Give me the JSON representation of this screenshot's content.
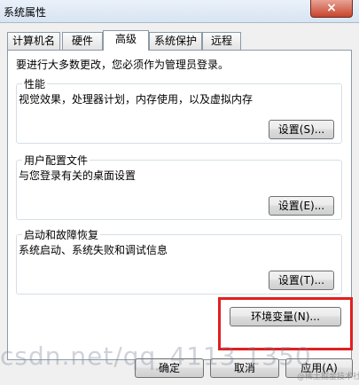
{
  "window": {
    "title": "系统属性",
    "close_glyph": "×"
  },
  "tabs": [
    "计算机名",
    "硬件",
    "高级",
    "系统保护",
    "远程"
  ],
  "admin_note": "要进行大多数更改，您必须作为管理员登录。",
  "groups": {
    "performance": {
      "title": "性能",
      "desc": "视觉效果，处理器计划，内存使用，以及虚拟内存",
      "button": "设置(S)..."
    },
    "profiles": {
      "title": "用户配置文件",
      "desc": "与您登录有关的桌面设置",
      "button": "设置(E)..."
    },
    "startup": {
      "title": "启动和故障恢复",
      "desc": "系统启动、系统失败和调试信息",
      "button": "设置(T)..."
    }
  },
  "env_button": "环境变量(N)...",
  "footer": {
    "ok": "确定",
    "cancel": "取消",
    "apply": "应用(A)"
  },
  "watermark": "csdn.net/qq_4113 1350",
  "watermark_small": "@稀土掘金技术社区",
  "colors": {
    "highlight": "#e02020"
  }
}
